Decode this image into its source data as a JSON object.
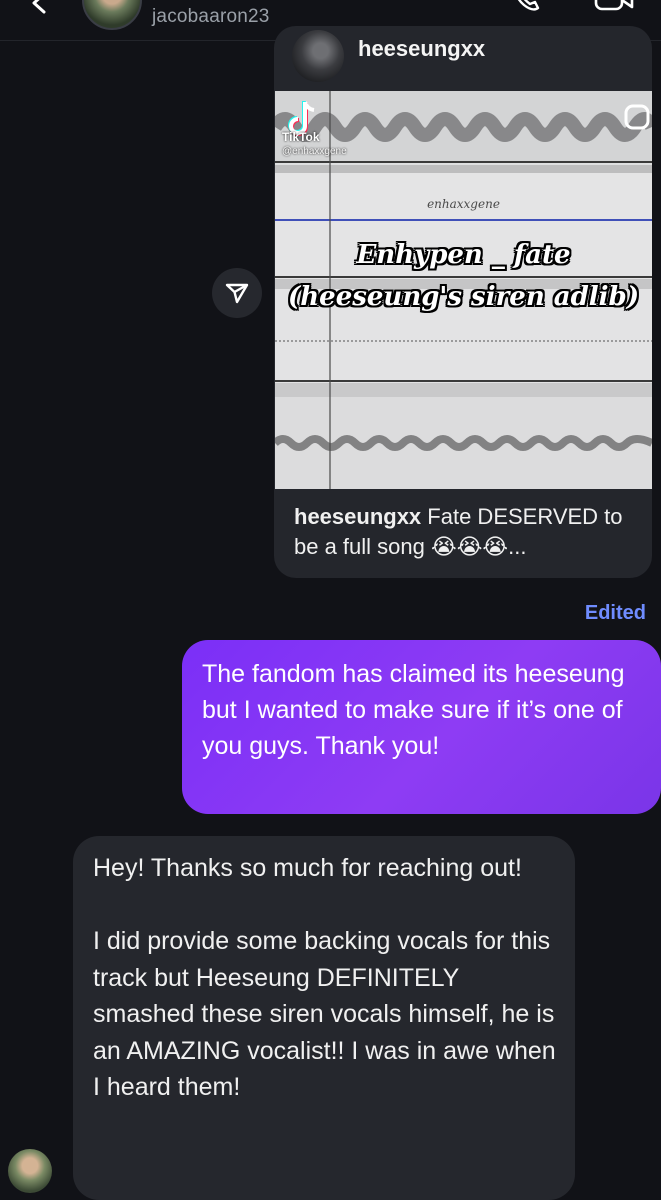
{
  "header": {
    "username": "jacobaaron23",
    "icons": [
      "back-icon",
      "phone-icon",
      "video-icon"
    ]
  },
  "shared_post": {
    "author": "heeseungxx",
    "video": {
      "platform_label": "TikTok",
      "handle": "@enhaxxgene",
      "watermark": "enhaxxgene",
      "overlay_line1": "Enhypen _ fate",
      "overlay_line2": "(heeseung's siren adlib)"
    },
    "caption_author": "heeseungxx",
    "caption_text": "Fate DESERVED to be a full song 😭😭😭...",
    "share_icon": "send-icon"
  },
  "edited_label": "Edited",
  "messages": {
    "outgoing": "The fandom has claimed its heeseung but I wanted to make sure if it’s one of you guys. Thank you!",
    "incoming": "Hey! Thanks so much for reaching out!\n\nI did provide some backing vocals for this track but Heeseung DEFINITELY smashed these siren vocals himself, he is an AMAZING vocalist!! I was in awe when I heard them!"
  },
  "colors": {
    "background": "#111217",
    "bubble_incoming": "#25272d",
    "bubble_outgoing": "#7b2ff7",
    "edited": "#6f8cff"
  }
}
